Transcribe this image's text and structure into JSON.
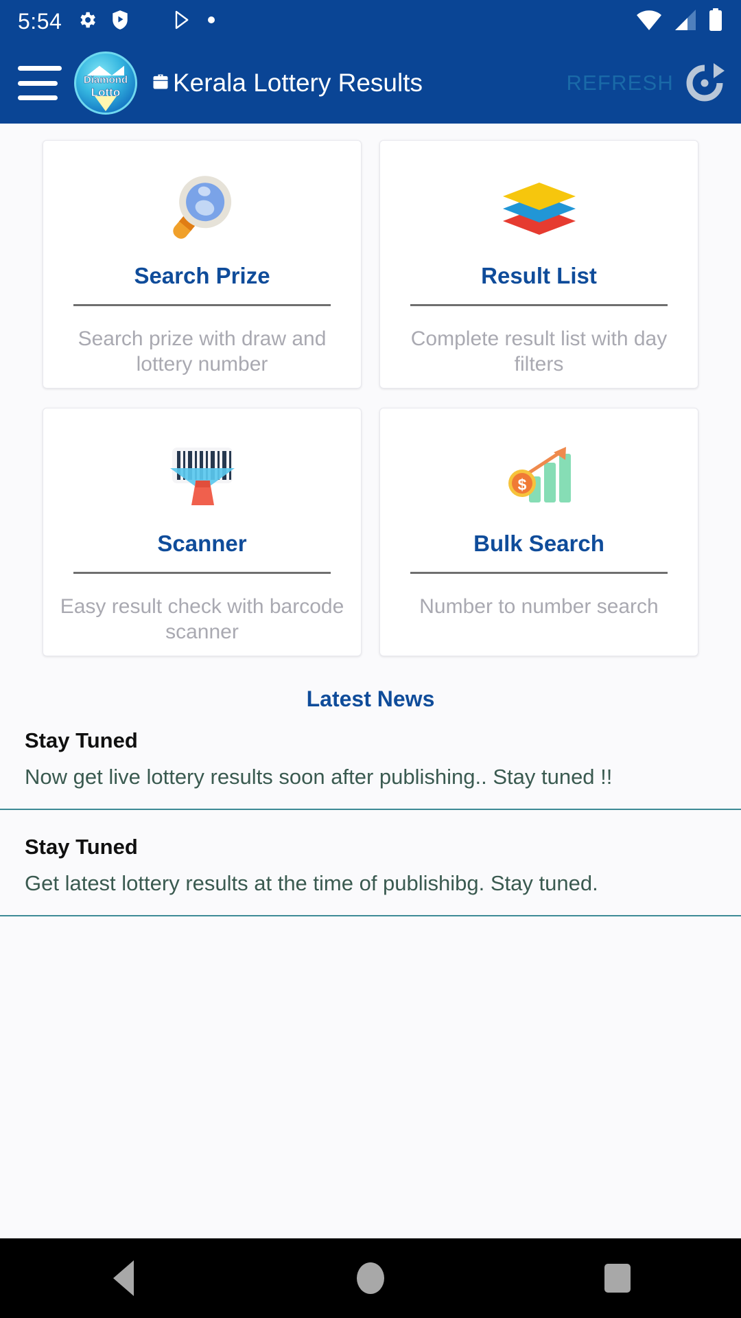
{
  "status_bar": {
    "time": "5:54",
    "left_icons": [
      "gear-icon",
      "shield-play-icon",
      "play-store-icon",
      "dot-icon"
    ],
    "right_icons": [
      "wifi-icon",
      "cellular-signal-icon",
      "battery-icon"
    ]
  },
  "app_bar": {
    "menu_icon": "hamburger-menu-icon",
    "logo_line1": "Diamond",
    "logo_line2": "Lotto",
    "title": "Kerala Lottery Results",
    "title_icon": "briefcase-icon",
    "refresh_label": "REFRESH",
    "refresh_icon": "refresh-circular-arrow-icon"
  },
  "colors": {
    "app_bar_bg": "#0a4595",
    "card_title": "#0f4c9a",
    "card_desc": "#a9a9b1",
    "refresh_label": "#1a6aa8",
    "news_divider": "#3c8a95",
    "news_body": "#3a5a50"
  },
  "cards": [
    {
      "title": "Search Prize",
      "desc": "Search prize with draw and lottery number",
      "icon": "magnifying-glass-icon"
    },
    {
      "title": "Result List",
      "desc": "Complete result list with day filters",
      "icon": "layers-stack-icon"
    },
    {
      "title": "Scanner",
      "desc": "Easy result check with barcode scanner",
      "icon": "barcode-scanner-icon"
    },
    {
      "title": "Bulk Search",
      "desc": "Number to number search",
      "icon": "growth-chart-coin-icon"
    }
  ],
  "news": {
    "heading": "Latest News",
    "items": [
      {
        "title": "Stay Tuned",
        "body": "Now get live lottery results soon after publishing.. Stay tuned !!"
      },
      {
        "title": "Stay Tuned",
        "body": "Get latest lottery results at the time of publishibg. Stay tuned."
      }
    ]
  },
  "nav_bar": {
    "back": "back-navigation-button",
    "home": "home-navigation-button",
    "recents": "recents-navigation-button"
  }
}
